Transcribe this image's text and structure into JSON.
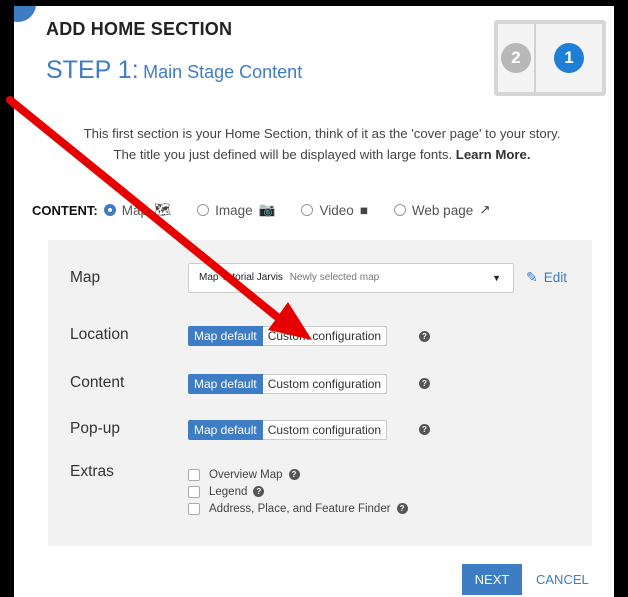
{
  "dialog": {
    "title": "ADD HOME SECTION",
    "step_number": "STEP 1:",
    "step_subtitle": "Main Stage Content",
    "intro_line1": "This first section is your Home Section, think of it as the 'cover page' to your story.",
    "intro_line2": "The title you just defined will be displayed with large fonts.",
    "learn_more": "Learn More."
  },
  "layout_thumbnail": {
    "left_number": "2",
    "right_number": "1"
  },
  "content": {
    "label": "CONTENT:",
    "options": [
      {
        "label": "Map",
        "selected": true,
        "icon": "map-icon",
        "glyph": "🗺"
      },
      {
        "label": "Image",
        "selected": false,
        "icon": "camera-icon",
        "glyph": "📷"
      },
      {
        "label": "Video",
        "selected": false,
        "icon": "video-icon",
        "glyph": "■"
      },
      {
        "label": "Web page",
        "selected": false,
        "icon": "external-link-icon",
        "glyph": "↗"
      }
    ]
  },
  "panel": {
    "map_label": "Map",
    "map_select_value": "Map Tutorial Jarvis",
    "map_select_note": "Newly selected map",
    "edit_label": "Edit",
    "location_label": "Location",
    "content_label": "Content",
    "popup_label": "Pop-up",
    "extras_label": "Extras",
    "map_default": "Map default",
    "custom_configuration": "Custom configuration",
    "help_glyph": "?",
    "extras": [
      {
        "label": "Overview Map",
        "help": true
      },
      {
        "label": "Legend",
        "help": true
      },
      {
        "label": "Address, Place, and Feature Finder",
        "help": true
      }
    ]
  },
  "footer": {
    "next_label": "NEXT",
    "cancel_label": "CANCEL"
  },
  "colors": {
    "accent": "#3e7cc4",
    "arrow": "#e60000",
    "panel_bg": "#f2f2f2"
  }
}
